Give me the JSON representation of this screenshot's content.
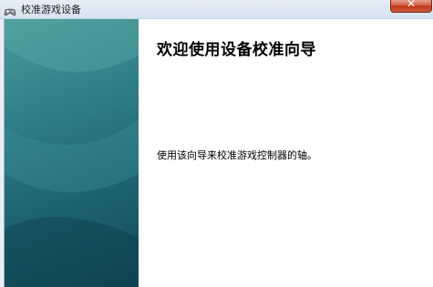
{
  "window": {
    "title": "校准游戏设备"
  },
  "wizard": {
    "heading": "欢迎使用设备校准向导",
    "description": "使用该向导来校准游戏控制器的轴。"
  },
  "icons": {
    "app": "game-controller-icon",
    "close": "close-icon"
  },
  "colors": {
    "side_panel": "#2f7e86",
    "close_button": "#c0391b",
    "titlebar": "#dbe6f3"
  }
}
